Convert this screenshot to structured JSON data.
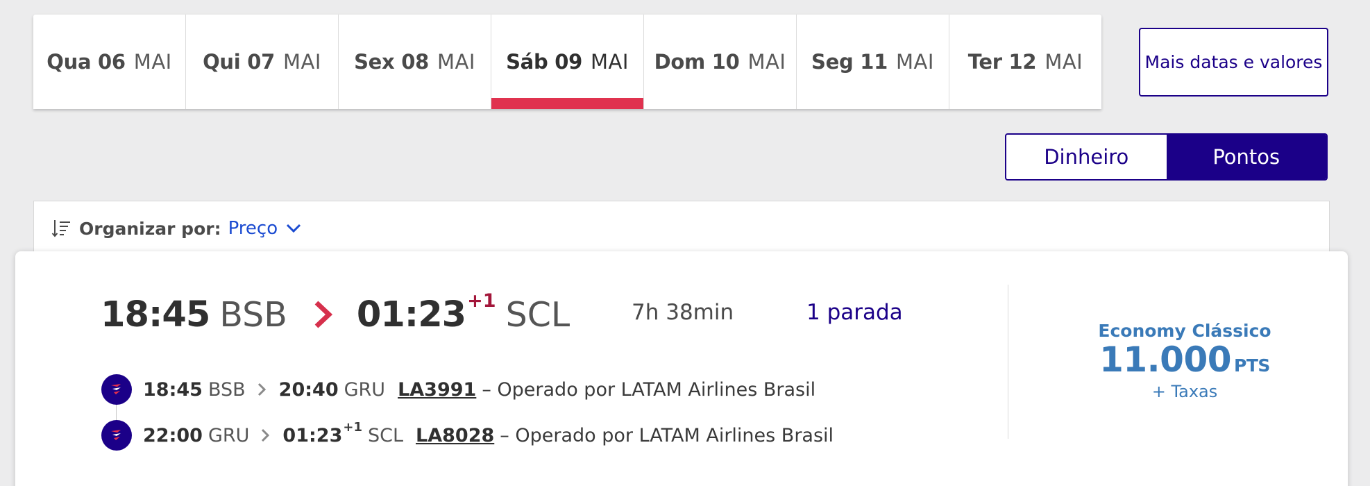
{
  "date_tabs": [
    {
      "day": "Qua 06",
      "month": "MAI",
      "active": false
    },
    {
      "day": "Qui 07",
      "month": "MAI",
      "active": false
    },
    {
      "day": "Sex 08",
      "month": "MAI",
      "active": false
    },
    {
      "day": "Sáb 09",
      "month": "MAI",
      "active": true
    },
    {
      "day": "Dom 10",
      "month": "MAI",
      "active": false
    },
    {
      "day": "Seg 11",
      "month": "MAI",
      "active": false
    },
    {
      "day": "Ter 12",
      "month": "MAI",
      "active": false
    }
  ],
  "more_dates_label": "Mais datas e valores",
  "currency_toggle": {
    "money_label": "Dinheiro",
    "points_label": "Pontos",
    "selected": "Pontos"
  },
  "sort": {
    "label": "Organizar por:",
    "value": "Preço",
    "icon": "sort-icon"
  },
  "flight": {
    "departure_time": "18:45",
    "departure_code": "BSB",
    "arrival_time": "01:23",
    "arrival_day_offset": "+1",
    "arrival_code": "SCL",
    "duration": "7h 38min",
    "stops": "1 parada",
    "fare": {
      "class": "Economy Clássico",
      "amount": "11.000",
      "unit": "PTS",
      "taxes": "+ Taxas"
    },
    "segments": [
      {
        "dep_time": "18:45",
        "dep_code": "BSB",
        "arr_time": "20:40",
        "arr_offset": "",
        "arr_code": "GRU",
        "flight_number": "LA3991",
        "operator": "– Operado por LATAM Airlines Brasil"
      },
      {
        "dep_time": "22:00",
        "dep_code": "GRU",
        "arr_time": "01:23",
        "arr_offset": "+1",
        "arr_code": "SCL",
        "flight_number": "LA8028",
        "operator": "– Operado por LATAM Airlines Brasil"
      }
    ]
  },
  "colors": {
    "brand": "#1b0088",
    "active_tab": "#e0324f",
    "fare": "#3a7ab8",
    "day_offset": "#a3163a",
    "link": "#1b4bd1"
  }
}
